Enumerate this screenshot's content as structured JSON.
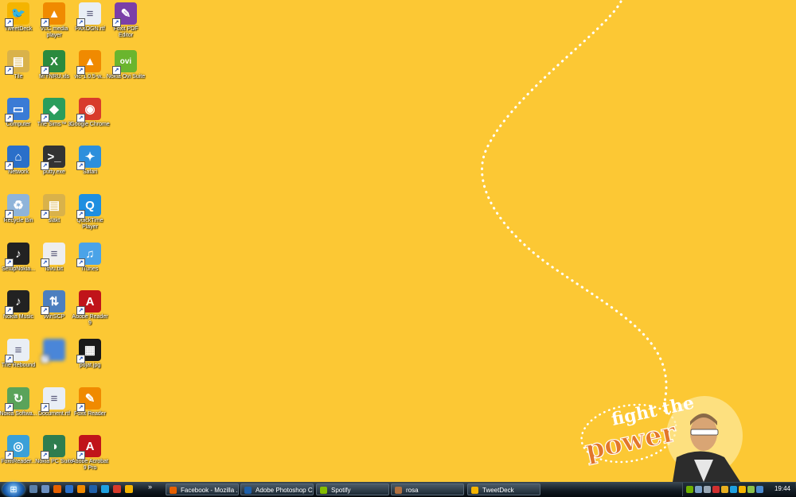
{
  "desktop": {
    "wallpaper_text": "fight the power",
    "icons": [
      {
        "label": "TweetDeck",
        "icon": "tweetdeck-icon",
        "color": "#f4b400",
        "glyph": "🐦"
      },
      {
        "label": "VLC media player",
        "icon": "vlc-icon",
        "color": "#f08a00",
        "glyph": "▲"
      },
      {
        "label": "PAXOGN.rtf",
        "icon": "document-icon",
        "color": "#e9eef5",
        "glyph": "≡"
      },
      {
        "label": "Foxit PDF Editor",
        "icon": "foxit-editor-icon",
        "color": "#7b3fa8",
        "glyph": "✎"
      },
      {
        "label": "Tile",
        "icon": "folder-icon",
        "color": "#d9b24a",
        "glyph": "▤"
      },
      {
        "label": "M!YNRU.xls",
        "icon": "excel-icon",
        "color": "#2b8a3e",
        "glyph": "X"
      },
      {
        "label": "vlc-1.0.5-w...",
        "icon": "vlc-icon",
        "color": "#f08a00",
        "glyph": "▲"
      },
      {
        "label": "Nokia Ovi Suite",
        "icon": "ovi-icon",
        "color": "#6ab52e",
        "glyph": "ovi"
      },
      {
        "label": "Computer",
        "icon": "computer-icon",
        "color": "#3a7bd5",
        "glyph": "▭"
      },
      {
        "label": "The Sims™ 3",
        "icon": "sims-icon",
        "color": "#2a9d5c",
        "glyph": "◆"
      },
      {
        "label": "Google Chrome",
        "icon": "chrome-icon",
        "color": "#d83b2b",
        "glyph": "◉"
      },
      {
        "label": "Network",
        "icon": "network-icon",
        "color": "#2a6fc9",
        "glyph": "⌂"
      },
      {
        "label": "putty.exe",
        "icon": "putty-icon",
        "color": "#333333",
        "glyph": ">_"
      },
      {
        "label": "Safari",
        "icon": "safari-icon",
        "color": "#2d8fdc",
        "glyph": "✦"
      },
      {
        "label": "Recycle Bin",
        "icon": "recycle-bin-icon",
        "color": "#8fb4d9",
        "glyph": "♻"
      },
      {
        "label": "släkt",
        "icon": "folder-icon",
        "color": "#d9b24a",
        "glyph": "▤"
      },
      {
        "label": "QuickTime Player",
        "icon": "quicktime-icon",
        "color": "#1f8fe0",
        "glyph": "Q"
      },
      {
        "label": "SetupNokia...",
        "icon": "nokia-music-icon",
        "color": "#222222",
        "glyph": "♪"
      },
      {
        "label": "lovu.txt",
        "icon": "text-file-icon",
        "color": "#eeeeee",
        "glyph": "≡"
      },
      {
        "label": "iTunes",
        "icon": "itunes-icon",
        "color": "#4aa3e8",
        "glyph": "♫"
      },
      {
        "label": "Nokia Music",
        "icon": "nokia-music-icon",
        "color": "#222222",
        "glyph": "♪"
      },
      {
        "label": "WinSCP",
        "icon": "winscp-icon",
        "color": "#4c7fbf",
        "glyph": "⇅"
      },
      {
        "label": "Adobe Reader 9",
        "icon": "adobe-reader-icon",
        "color": "#c0141a",
        "glyph": "A"
      },
      {
        "label": "The Rebound",
        "icon": "document-icon",
        "color": "#e9eef5",
        "glyph": "≡"
      },
      {
        "label": "",
        "icon": "blurred-icon",
        "color": "#4a86d8",
        "glyph": ""
      },
      {
        "label": "pojat.jpg",
        "icon": "image-file-icon",
        "color": "#1a1a1a",
        "glyph": "▦"
      },
      {
        "label": "Nokia Softwa...",
        "icon": "nokia-software-icon",
        "color": "#5aa35a",
        "glyph": "↻"
      },
      {
        "label": "Document.rtf",
        "icon": "document-icon",
        "color": "#e9eef5",
        "glyph": "≡"
      },
      {
        "label": "Foxit Reader",
        "icon": "foxit-reader-icon",
        "color": "#f08a00",
        "glyph": "✎"
      },
      {
        "label": "FoxitReader...",
        "icon": "installer-icon",
        "color": "#3aa0d8",
        "glyph": "◎"
      },
      {
        "label": "Nokia PC Suite",
        "icon": "nokia-pc-suite-icon",
        "color": "#2e7d4f",
        "glyph": "◑"
      },
      {
        "label": "Adobe Acrobat 9 Pro",
        "icon": "adobe-acrobat-icon",
        "color": "#c0141a",
        "glyph": "A"
      }
    ]
  },
  "taskbar": {
    "quick_launch": [
      "show-desktop-icon",
      "switch-windows-icon",
      "firefox-icon",
      "outlook-icon",
      "media-player-icon",
      "photoshop-icon",
      "skype-icon",
      "chrome-icon",
      "tweetdeck-icon"
    ],
    "overflow": "»",
    "tasks": [
      {
        "label": "Facebook - Mozilla ...",
        "icon": "firefox-icon",
        "color": "#e66000"
      },
      {
        "label": "Adobe Photoshop C...",
        "icon": "photoshop-icon",
        "color": "#1f5fa8"
      },
      {
        "label": "Spotify",
        "icon": "spotify-icon",
        "color": "#84bd00"
      },
      {
        "label": "rosa",
        "icon": "image-file-icon",
        "color": "#b07040"
      },
      {
        "label": "TweetDeck",
        "icon": "tweetdeck-icon",
        "color": "#f4b400"
      }
    ],
    "tray_icons": [
      "nvidia-icon",
      "network-tray-icon",
      "volume-icon",
      "security-icon",
      "update-icon",
      "skype-tray-icon",
      "tweetdeck-tray-icon",
      "battery-icon",
      "language-icon"
    ],
    "clock": "19:44"
  }
}
